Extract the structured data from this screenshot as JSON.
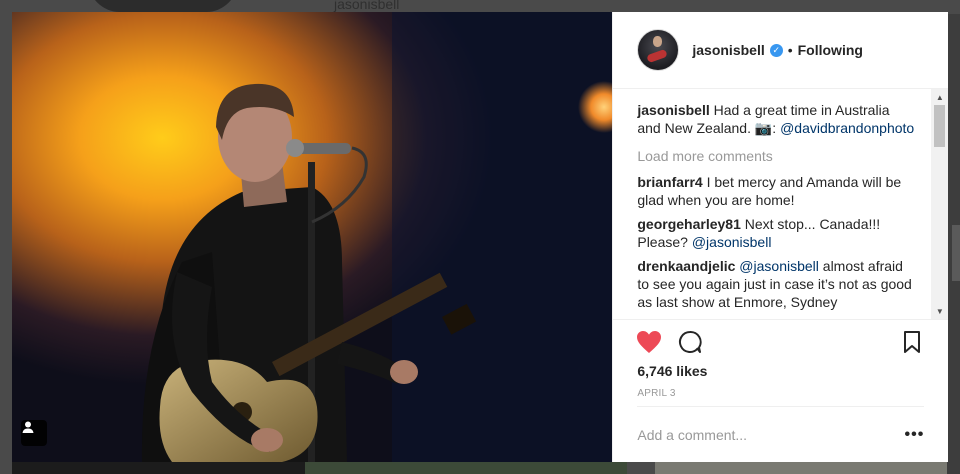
{
  "background": {
    "top_username": "jasonisbell"
  },
  "post": {
    "author": "jasonisbell",
    "verified": true,
    "follow_status": "Following",
    "caption": {
      "user": "jasonisbell",
      "text": "Had a great time in Australia and New Zealand. 📷:",
      "mention": "@davidbrandonphoto"
    },
    "load_more": "Load more comments",
    "comments": [
      {
        "user": "brianfarr4",
        "text": "I bet mercy and Amanda will be glad when you are home!",
        "mention": ""
      },
      {
        "user": "georgeharley81",
        "text": "Next stop... Canada!!! Please?",
        "mention": "@jasonisbell"
      },
      {
        "user": "drenkaandjelic",
        "mention": "@jasonisbell",
        "text": "almost afraid to see you again just in case it’s not as good as last show at Enmore, Sydney"
      }
    ],
    "likes": "6,746 likes",
    "date": "APRIL 3",
    "add_comment_placeholder": "Add a comment...",
    "more_label": "•••",
    "dot": "•"
  },
  "colors": {
    "like": "#ed4956",
    "verified": "#3897f0",
    "mention": "#003569"
  },
  "icons": {
    "like": "heart-icon",
    "comment": "speech-bubble-icon",
    "save": "bookmark-icon",
    "tag": "user-tag-icon",
    "verified": "verified-badge-icon"
  }
}
